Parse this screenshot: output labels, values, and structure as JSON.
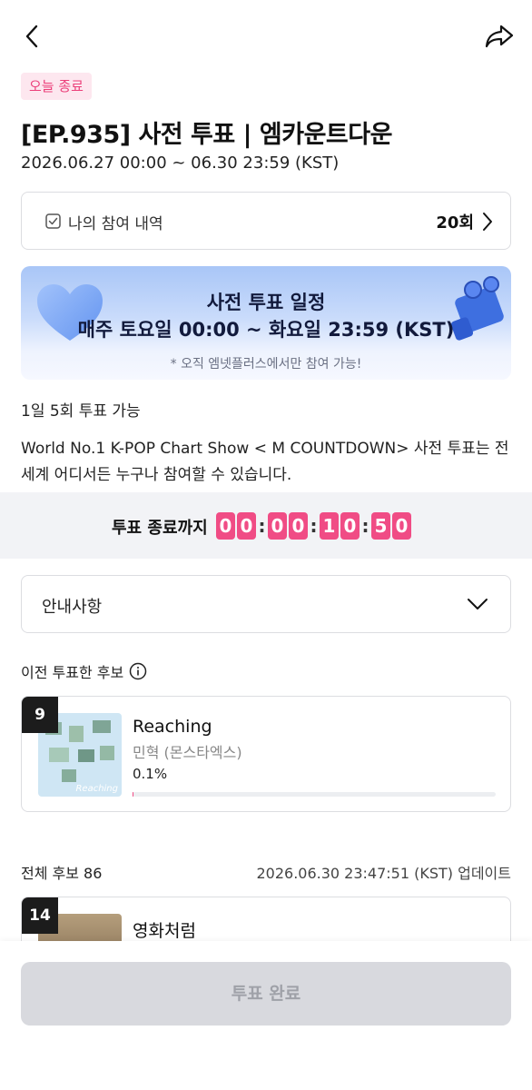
{
  "header": {
    "back_icon": "chevron-left-icon",
    "share_icon": "share-icon"
  },
  "status_badge": "오늘 종료",
  "title": "[EP.935] 사전 투표 | 엠카운트다운",
  "period": "2026.06.27 00:00 ~ 06.30 23:59 (KST)",
  "history": {
    "label": "나의 참여 내역",
    "count": "20회"
  },
  "banner": {
    "title": "사전 투표 일정",
    "schedule": "매주 토요일 00:00 ~ 화요일 23:59 (KST)",
    "note": "* 오직 엠넷플러스에서만 참여 가능!"
  },
  "daily_limit": "1일 5회 투표 가능",
  "description": "World No.1 K-POP Chart Show  < M COUNTDOWN> 사전 투표는 전 세계 어디서든 누구나 참여할 수 있습니다.",
  "countdown": {
    "label": "투표 종료까지",
    "digits": [
      "0",
      "0",
      "0",
      "0",
      "1",
      "0",
      "5",
      "0"
    ]
  },
  "notice": {
    "label": "안내사항"
  },
  "previous": {
    "label": "이전 투표한 후보",
    "candidate": {
      "rank": "9",
      "song": "Reaching",
      "artist": "민혁 (몬스타엑스)",
      "percent": "0.1%",
      "percent_value": 0.1,
      "thumb_label": "Reaching"
    }
  },
  "list": {
    "total": "전체 후보 86",
    "updated": "2026.06.30 23:47:51 (KST) 업데이트",
    "first": {
      "rank": "14",
      "song": "영화처럼"
    }
  },
  "vote_button": "투표 완료",
  "colors": {
    "accent": "#f04c85",
    "badge_bg": "#fde7ef",
    "disabled": "#d8d9de"
  }
}
